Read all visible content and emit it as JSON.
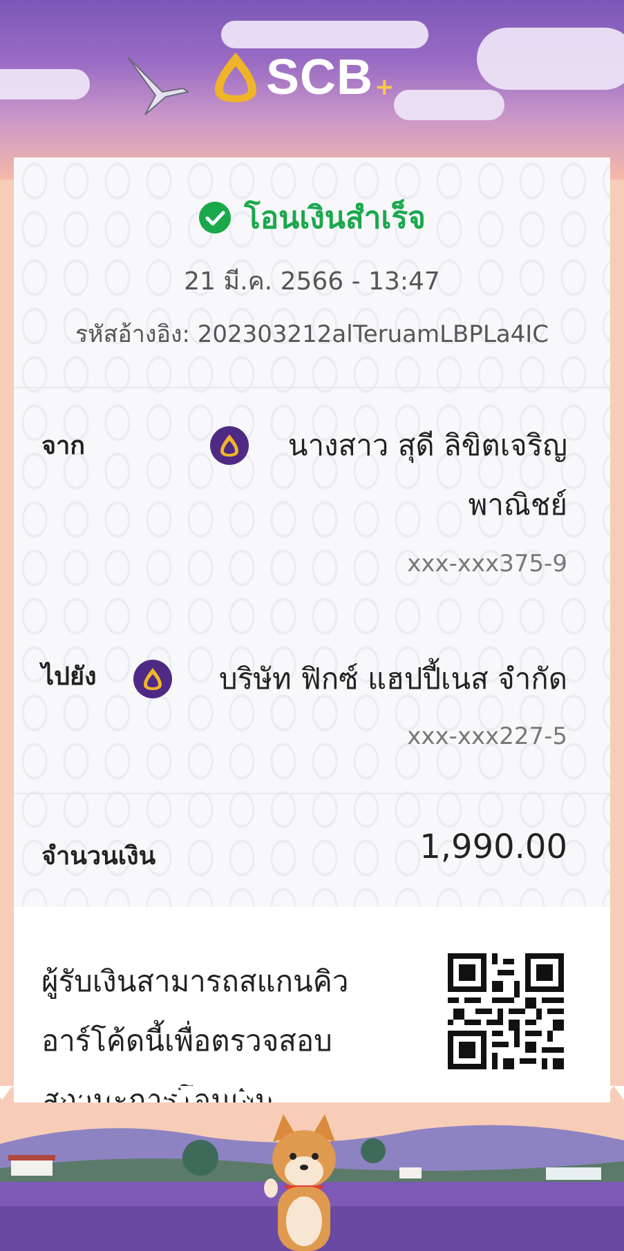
{
  "brand": {
    "name": "SCB",
    "plus": "+",
    "accent": "#4e2a84",
    "gold": "#f0b429"
  },
  "status": {
    "title": "โอนเงินสำเร็จ",
    "icon": "check-circle-icon",
    "color": "#1aa84b"
  },
  "datetime": "21 มี.ค. 2566 - 13:47",
  "reference": "รหัสอ้างอิง: 202303212alTeruamLBPLa4IC",
  "from": {
    "label": "จาก",
    "name_line1": "นางสาว สุดี ลิขิตเจริญ",
    "name_line2": "พาณิชย์",
    "account": "xxx-xxx375-9",
    "bank_icon": "scb-bank-icon"
  },
  "to": {
    "label": "ไปยัง",
    "name": "บริษัท ฟิกซ์ แฮปปี้เนส จำกัด",
    "account": "xxx-xxx227-5",
    "bank_icon": "scb-bank-icon"
  },
  "amount": {
    "label": "จำนวนเงิน",
    "value": "1,990.00"
  },
  "qr": {
    "note_line1": "ผู้รับเงินสามารถสแกนคิว",
    "note_line2": "อาร์โค้ดนี้เพื่อตรวจสอบ",
    "note_line3": "สถานะการโอนเงิน"
  }
}
